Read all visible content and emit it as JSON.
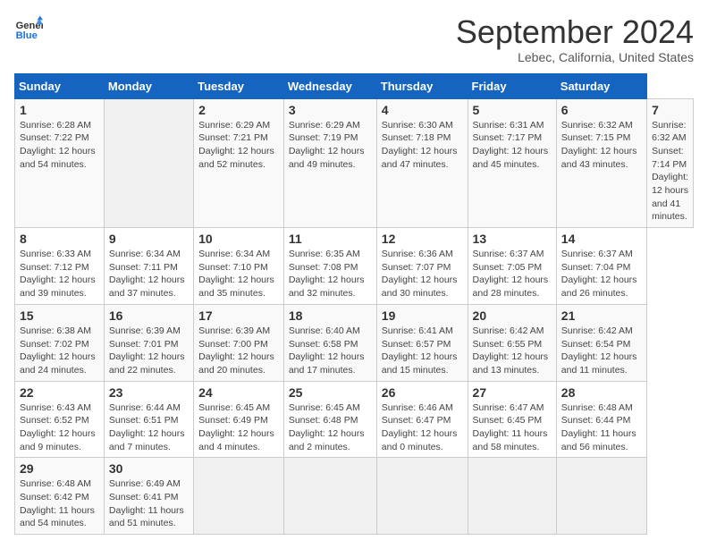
{
  "header": {
    "logo_line1": "General",
    "logo_line2": "Blue",
    "title": "September 2024",
    "location": "Lebec, California, United States"
  },
  "calendar": {
    "days_of_week": [
      "Sunday",
      "Monday",
      "Tuesday",
      "Wednesday",
      "Thursday",
      "Friday",
      "Saturday"
    ],
    "weeks": [
      [
        {
          "num": "",
          "empty": true
        },
        {
          "num": "2",
          "detail": "Sunrise: 6:29 AM\nSunset: 7:21 PM\nDaylight: 12 hours\nand 52 minutes."
        },
        {
          "num": "3",
          "detail": "Sunrise: 6:29 AM\nSunset: 7:19 PM\nDaylight: 12 hours\nand 49 minutes."
        },
        {
          "num": "4",
          "detail": "Sunrise: 6:30 AM\nSunset: 7:18 PM\nDaylight: 12 hours\nand 47 minutes."
        },
        {
          "num": "5",
          "detail": "Sunrise: 6:31 AM\nSunset: 7:17 PM\nDaylight: 12 hours\nand 45 minutes."
        },
        {
          "num": "6",
          "detail": "Sunrise: 6:32 AM\nSunset: 7:15 PM\nDaylight: 12 hours\nand 43 minutes."
        },
        {
          "num": "7",
          "detail": "Sunrise: 6:32 AM\nSunset: 7:14 PM\nDaylight: 12 hours\nand 41 minutes."
        }
      ],
      [
        {
          "num": "8",
          "detail": "Sunrise: 6:33 AM\nSunset: 7:12 PM\nDaylight: 12 hours\nand 39 minutes."
        },
        {
          "num": "9",
          "detail": "Sunrise: 6:34 AM\nSunset: 7:11 PM\nDaylight: 12 hours\nand 37 minutes."
        },
        {
          "num": "10",
          "detail": "Sunrise: 6:34 AM\nSunset: 7:10 PM\nDaylight: 12 hours\nand 35 minutes."
        },
        {
          "num": "11",
          "detail": "Sunrise: 6:35 AM\nSunset: 7:08 PM\nDaylight: 12 hours\nand 32 minutes."
        },
        {
          "num": "12",
          "detail": "Sunrise: 6:36 AM\nSunset: 7:07 PM\nDaylight: 12 hours\nand 30 minutes."
        },
        {
          "num": "13",
          "detail": "Sunrise: 6:37 AM\nSunset: 7:05 PM\nDaylight: 12 hours\nand 28 minutes."
        },
        {
          "num": "14",
          "detail": "Sunrise: 6:37 AM\nSunset: 7:04 PM\nDaylight: 12 hours\nand 26 minutes."
        }
      ],
      [
        {
          "num": "15",
          "detail": "Sunrise: 6:38 AM\nSunset: 7:02 PM\nDaylight: 12 hours\nand 24 minutes."
        },
        {
          "num": "16",
          "detail": "Sunrise: 6:39 AM\nSunset: 7:01 PM\nDaylight: 12 hours\nand 22 minutes."
        },
        {
          "num": "17",
          "detail": "Sunrise: 6:39 AM\nSunset: 7:00 PM\nDaylight: 12 hours\nand 20 minutes."
        },
        {
          "num": "18",
          "detail": "Sunrise: 6:40 AM\nSunset: 6:58 PM\nDaylight: 12 hours\nand 17 minutes."
        },
        {
          "num": "19",
          "detail": "Sunrise: 6:41 AM\nSunset: 6:57 PM\nDaylight: 12 hours\nand 15 minutes."
        },
        {
          "num": "20",
          "detail": "Sunrise: 6:42 AM\nSunset: 6:55 PM\nDaylight: 12 hours\nand 13 minutes."
        },
        {
          "num": "21",
          "detail": "Sunrise: 6:42 AM\nSunset: 6:54 PM\nDaylight: 12 hours\nand 11 minutes."
        }
      ],
      [
        {
          "num": "22",
          "detail": "Sunrise: 6:43 AM\nSunset: 6:52 PM\nDaylight: 12 hours\nand 9 minutes."
        },
        {
          "num": "23",
          "detail": "Sunrise: 6:44 AM\nSunset: 6:51 PM\nDaylight: 12 hours\nand 7 minutes."
        },
        {
          "num": "24",
          "detail": "Sunrise: 6:45 AM\nSunset: 6:49 PM\nDaylight: 12 hours\nand 4 minutes."
        },
        {
          "num": "25",
          "detail": "Sunrise: 6:45 AM\nSunset: 6:48 PM\nDaylight: 12 hours\nand 2 minutes."
        },
        {
          "num": "26",
          "detail": "Sunrise: 6:46 AM\nSunset: 6:47 PM\nDaylight: 12 hours\nand 0 minutes."
        },
        {
          "num": "27",
          "detail": "Sunrise: 6:47 AM\nSunset: 6:45 PM\nDaylight: 11 hours\nand 58 minutes."
        },
        {
          "num": "28",
          "detail": "Sunrise: 6:48 AM\nSunset: 6:44 PM\nDaylight: 11 hours\nand 56 minutes."
        }
      ],
      [
        {
          "num": "29",
          "detail": "Sunrise: 6:48 AM\nSunset: 6:42 PM\nDaylight: 11 hours\nand 54 minutes."
        },
        {
          "num": "30",
          "detail": "Sunrise: 6:49 AM\nSunset: 6:41 PM\nDaylight: 11 hours\nand 51 minutes."
        },
        {
          "num": "",
          "empty": true
        },
        {
          "num": "",
          "empty": true
        },
        {
          "num": "",
          "empty": true
        },
        {
          "num": "",
          "empty": true
        },
        {
          "num": "",
          "empty": true
        }
      ]
    ],
    "week0": {
      "sun": {
        "num": "1",
        "detail": "Sunrise: 6:28 AM\nSunset: 7:22 PM\nDaylight: 12 hours\nand 54 minutes."
      }
    }
  }
}
